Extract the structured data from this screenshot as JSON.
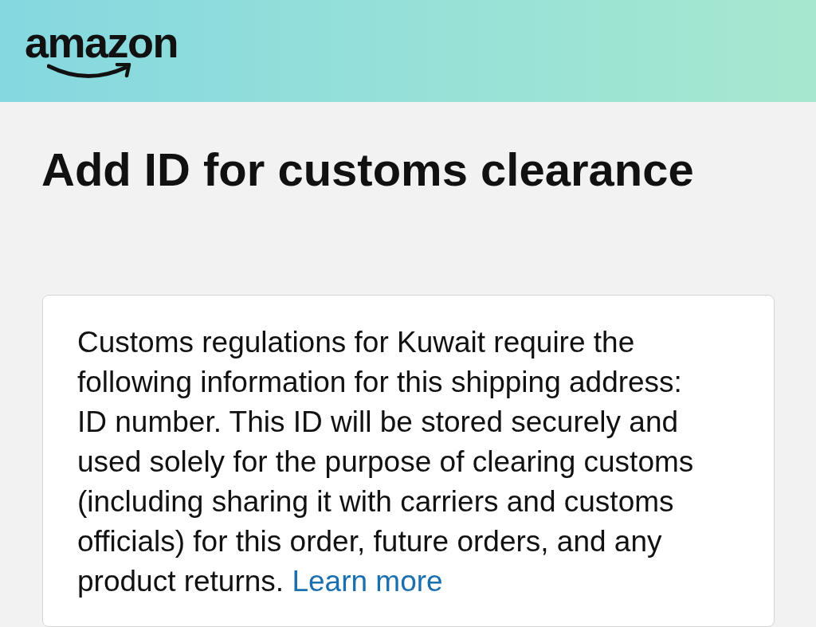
{
  "header": {
    "logo": "amazon"
  },
  "title": "Add ID for customs clearance",
  "notice": {
    "text": "Customs regulations for Kuwait require the following information for this shipping address: ID number. This ID will be stored securely and used solely for the purpose of clearing customs (including sharing it with carriers and customs officials) for this order, future orders, and any product returns.",
    "link": "Learn more"
  }
}
